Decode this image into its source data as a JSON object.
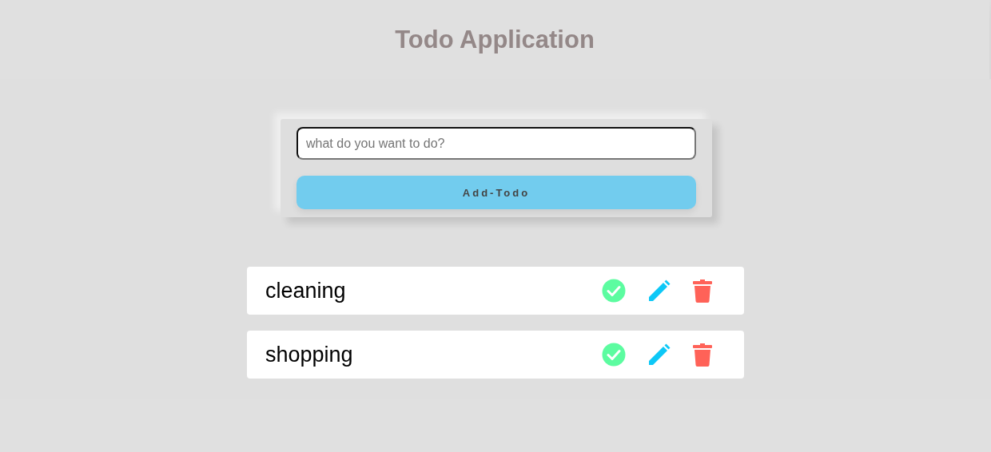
{
  "header": {
    "title": "Todo Application"
  },
  "form": {
    "input": {
      "placeholder": "what do you want to do?"
    },
    "button": "Add-Todo"
  },
  "todos": [
    {
      "text": "cleaning"
    },
    {
      "text": "shopping"
    }
  ]
}
